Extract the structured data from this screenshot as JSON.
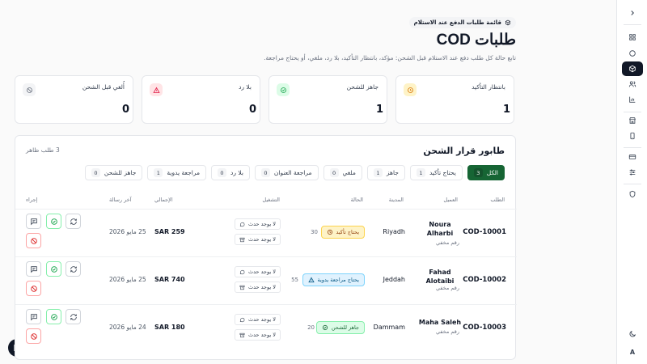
{
  "header": {
    "breadcrumb": "قائمة طلبات الدفع عند الاستلام",
    "title": "طلبات COD",
    "subtitle": "تابع حالة كل طلب دفع عند الاستلام قبل الشحن: مؤكد، بانتظار التأكيد، بلا رد، ملغي، أو يحتاج مراجعة."
  },
  "stats": [
    {
      "label": "بانتظار التأكيد",
      "value": "1",
      "icon": "clock-icon",
      "color": "#f59e0b"
    },
    {
      "label": "جاهز للشحن",
      "value": "1",
      "icon": "check-circle-icon",
      "color": "#16a34a"
    },
    {
      "label": "بلا رد",
      "value": "0",
      "icon": "alert-triangle-icon",
      "color": "#e11d48"
    },
    {
      "label": "أُلغي قبل الشحن",
      "value": "0",
      "icon": "ban-icon",
      "color": "#6b7280"
    }
  ],
  "panel": {
    "title": "طابور قرار الشحن",
    "count": "3 طلب ظاهر",
    "tabs": [
      {
        "label": "الكل",
        "count": "3",
        "active": true
      },
      {
        "label": "يحتاج تأكيد",
        "count": "1"
      },
      {
        "label": "جاهز",
        "count": "1"
      },
      {
        "label": "ملغي",
        "count": "0"
      },
      {
        "label": "مراجعة العنوان",
        "count": "0"
      },
      {
        "label": "بلا رد",
        "count": "0"
      },
      {
        "label": "مراجعة يدوية",
        "count": "1"
      },
      {
        "label": "جاهز للشحن",
        "count": "0"
      }
    ],
    "columns": {
      "order": "الطلب",
      "customer": "العميل",
      "city": "المدينة",
      "status": "الحالة",
      "operation": "التشغيل",
      "total": "الإجمالي",
      "last_message": "آخر رسالة",
      "action": "إجراء"
    },
    "rows": [
      {
        "id": "COD-10001",
        "name": "Noura Alharbi",
        "phone": "رقم مخفي",
        "city": "Riyadh",
        "status": "يحتاج تأكيد",
        "status_icon": "clock-icon",
        "score": "30",
        "op1": "لا يوجد حدث",
        "op2": "لا يوجد حدث",
        "total": "SAR 259",
        "date": "25 مايو 2026"
      },
      {
        "id": "COD-10002",
        "name": "Fahad Alotaibi",
        "phone": "رقم مخفي",
        "city": "Jeddah",
        "status": "يحتاج مراجعة يدوية",
        "status_icon": "alert-triangle-icon",
        "score": "55",
        "op1": "لا يوجد حدث",
        "op2": "لا يوجد حدث",
        "total": "SAR 740",
        "date": "25 مايو 2026"
      },
      {
        "id": "COD-10003",
        "name": "Maha Saleh",
        "phone": "رقم مخفي",
        "city": "Dammam",
        "status": "جاهز للشحن",
        "status_icon": "check-circle-icon",
        "score": "20",
        "op1": "لا يوجد حدث",
        "op2": "لا يوجد حدث",
        "total": "SAR 180",
        "date": "24 مايو 2026"
      }
    ]
  },
  "sidebar": {
    "items": [
      "chevron-right-icon",
      "grid-icon",
      "circle-icon",
      "box-icon",
      "users-icon",
      "chart-icon",
      "store-icon",
      "phone-icon",
      "card-icon",
      "sliders-icon",
      "shield-icon",
      "moon-icon"
    ],
    "letter": "A"
  },
  "logo": "N"
}
